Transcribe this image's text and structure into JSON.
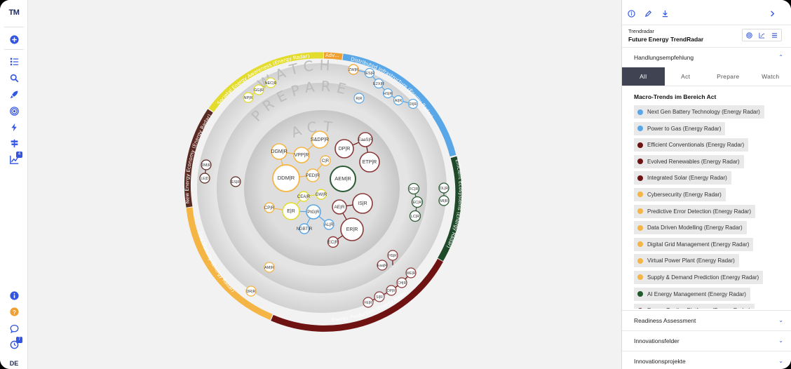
{
  "app": {
    "logo": "TM",
    "language": "DE"
  },
  "nav": {
    "items": [
      {
        "name": "add-icon"
      },
      {
        "name": "list-icon"
      },
      {
        "name": "search-icon"
      },
      {
        "name": "rocket-icon"
      },
      {
        "name": "radar-icon"
      },
      {
        "name": "bolt-icon"
      },
      {
        "name": "signpost-icon"
      },
      {
        "name": "chart-icon",
        "badge": "4"
      }
    ],
    "bottom": [
      {
        "name": "info-icon"
      },
      {
        "name": "help-icon"
      },
      {
        "name": "chat-icon"
      },
      {
        "name": "history-icon",
        "badge": "7"
      }
    ]
  },
  "colors": {
    "blue": "#5aa7e8",
    "yellow": "#e3dc2d",
    "orange": "#f5b545",
    "darkred": "#6e1212",
    "green": "#2b5a35",
    "brown": "#5a2a22",
    "accent": "#3355e0"
  },
  "radar": {
    "rings": {
      "watch": "WATCH",
      "prepare": "PREPARE",
      "act": "ACT"
    },
    "segments": [
      {
        "label": "Adv...",
        "color": "#f0a030"
      },
      {
        "label": "Distributed Infrastructure (Energy Radar)",
        "color": "#5aa7e8"
      },
      {
        "label": "Efficient Ecosystems (Energy Radar)",
        "color": "#1f4a2a"
      },
      {
        "label": "Energy Production (Energy Radar)",
        "color": "#6e1212"
      },
      {
        "label": "Grid Stability (Energy Radar)",
        "color": "#f5b545"
      },
      {
        "label": "New Energy Economy (Energy Radar)",
        "color": "#5a2a22"
      },
      {
        "label": "Societal Energy Awareness (Energy Radar)",
        "color": "#e3dc2d"
      }
    ],
    "nodes": {
      "n1": "ZW|R",
      "n2": "IES|R",
      "n3": "E2X|R",
      "n4": "HS|R",
      "n5": "AI|R",
      "n6": "DI|R",
      "n7": "R|R",
      "n8": "NEC|R",
      "n9": "GG|R",
      "n10": "NP|R",
      "n11": "S&DP|R",
      "n12": "DGM|R",
      "n13": "VPP|R",
      "n14": "C|R",
      "n15": "DDM|R",
      "n16": "PED|R",
      "n17": "CEA|R",
      "n18": "GW|R",
      "n19": "CP|R",
      "n20": "E|R",
      "n21": "PtG|R",
      "n22": "AL|R",
      "n23": "NGBT|R",
      "n24": "EaaS|R",
      "n25": "DP|R",
      "n26": "ETP|R",
      "n27": "AEM|R",
      "n28": "IS|R",
      "n29": "AE|R",
      "n30": "ER|R",
      "n31": "EC|R",
      "n32": "ES|R",
      "n33": "DM|R",
      "n34": "LE|D",
      "n35": "FC|R",
      "n36": "EC|R",
      "n37": "LC|R",
      "n38": "DL|R",
      "n39": "MI|R",
      "n40": "AM|R",
      "n41": "DR|R",
      "n42": "HS|R",
      "n43": "Eaa|R",
      "n44": "WE|R",
      "n45": "CH|R",
      "n46": "DP|R",
      "n47": "SI|R",
      "n48": "FE|R"
    }
  },
  "panel": {
    "breadcrumb": "Trendradar",
    "title": "Future Energy TrendRadar",
    "section_handlung": "Handlungsempfehlung",
    "tabs": [
      "All",
      "Act",
      "Prepare",
      "Watch"
    ],
    "list_title": "Macro-Trends im Bereich Act",
    "trends": [
      {
        "label": "Next Gen Battery Technology (Energy Radar)",
        "color": "#5aa7e8"
      },
      {
        "label": "Power to Gas (Energy Radar)",
        "color": "#5aa7e8"
      },
      {
        "label": "Efficient Conventionals (Energy Radar)",
        "color": "#6e1212"
      },
      {
        "label": "Evolved Renewables (Energy Radar)",
        "color": "#6e1212"
      },
      {
        "label": "Integrated Solar (Energy Radar)",
        "color": "#6e1212"
      },
      {
        "label": "Cybersecurity (Energy Radar)",
        "color": "#f5b545"
      },
      {
        "label": "Predictive Error Detection (Energy Radar)",
        "color": "#f5b545"
      },
      {
        "label": "Data Driven Modelling (Energy Radar)",
        "color": "#f5b545"
      },
      {
        "label": "Digital Grid Management (Energy Radar)",
        "color": "#f5b545"
      },
      {
        "label": "Virtual Power Plant (Energy Radar)",
        "color": "#f5b545"
      },
      {
        "label": "Supply & Demand Prediction (Energy Radar)",
        "color": "#f5b545"
      },
      {
        "label": "AI Energy Management (Energy Radar)",
        "color": "#1f5a2a"
      },
      {
        "label": "Energy Trading Platforms (Energy Radar)",
        "color": "#5a2a22"
      }
    ],
    "sections": [
      "Readiness Assessment",
      "Innovationsfelder",
      "Innovationsprojekte"
    ]
  }
}
